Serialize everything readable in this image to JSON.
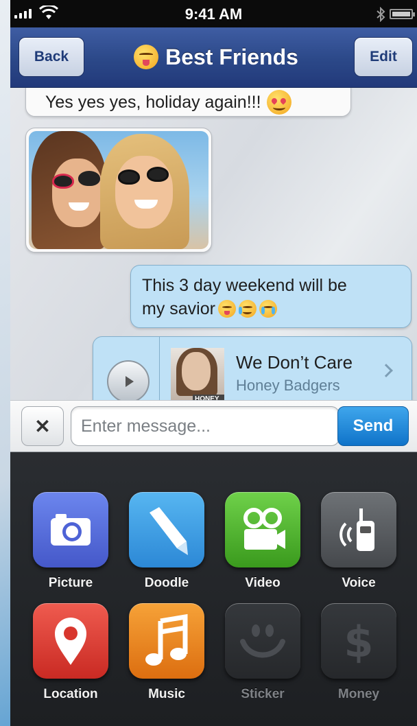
{
  "status_bar": {
    "time": "9:41 AM"
  },
  "nav": {
    "back_label": "Back",
    "title": "Best Friends",
    "edit_label": "Edit"
  },
  "messages": [
    {
      "type": "text",
      "direction": "incoming",
      "text": "Yes yes yes, holiday again!!!"
    },
    {
      "type": "photo",
      "direction": "incoming"
    },
    {
      "type": "text",
      "direction": "outgoing",
      "line1": "This 3 day weekend will be",
      "line2": "my savior"
    },
    {
      "type": "music",
      "direction": "outgoing",
      "song": "We Don’t Care",
      "artist": "Honey Badgers",
      "album_caption": "HONEY BADGERS"
    }
  ],
  "composer": {
    "placeholder": "Enter message...",
    "value": "",
    "send_label": "Send"
  },
  "attachments": [
    {
      "label": "Picture",
      "icon": "camera-icon",
      "enabled": true
    },
    {
      "label": "Doodle",
      "icon": "pencil-icon",
      "enabled": true
    },
    {
      "label": "Video",
      "icon": "video-camera-icon",
      "enabled": true
    },
    {
      "label": "Voice",
      "icon": "walkie-talkie-icon",
      "enabled": true
    },
    {
      "label": "Location",
      "icon": "map-pin-icon",
      "enabled": true
    },
    {
      "label": "Music",
      "icon": "music-note-icon",
      "enabled": true
    },
    {
      "label": "Sticker",
      "icon": "smiley-icon",
      "enabled": false
    },
    {
      "label": "Money",
      "icon": "dollar-icon",
      "enabled": false
    }
  ],
  "colors": {
    "nav_bar": "#2b4888",
    "outgoing_bubble": "#bfe1f6",
    "incoming_bubble": "#fafafa",
    "send_button": "#1a82d6",
    "panel_background": "#1d1f22"
  }
}
